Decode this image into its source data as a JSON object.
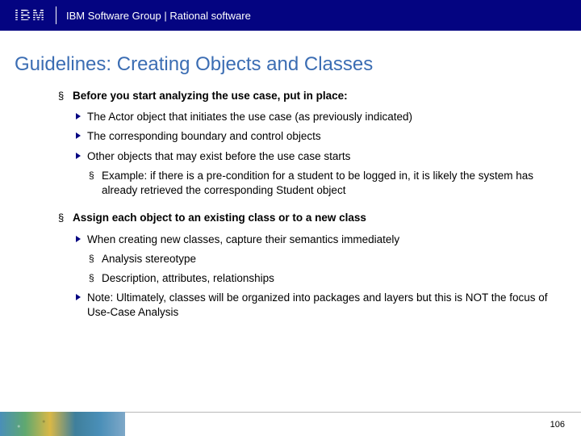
{
  "header": {
    "logo_text": "IBM",
    "group_text": "IBM Software Group | Rational software"
  },
  "title": "Guidelines: Creating Objects and Classes",
  "bullets": {
    "s1": {
      "heading": "Before you start analyzing the use case, put in place:",
      "b1": "The Actor object that initiates the use case (as previously indicated)",
      "b2": "The corresponding boundary and control objects",
      "b3": "Other objects that may exist before the use case starts",
      "b3_ex": "Example: if there is a pre-condition for a student to be logged in, it is likely the system has already retrieved the corresponding Student object"
    },
    "s2": {
      "heading": "Assign each object to an existing class or to a new class",
      "b1": "When creating new classes, capture their semantics immediately",
      "b1_a": "Analysis stereotype",
      "b1_b": "Description, attributes, relationships",
      "b2": "Note: Ultimately, classes will be organized into packages and layers but this is NOT the focus of Use-Case Analysis"
    }
  },
  "footer": {
    "page_number": "106"
  }
}
